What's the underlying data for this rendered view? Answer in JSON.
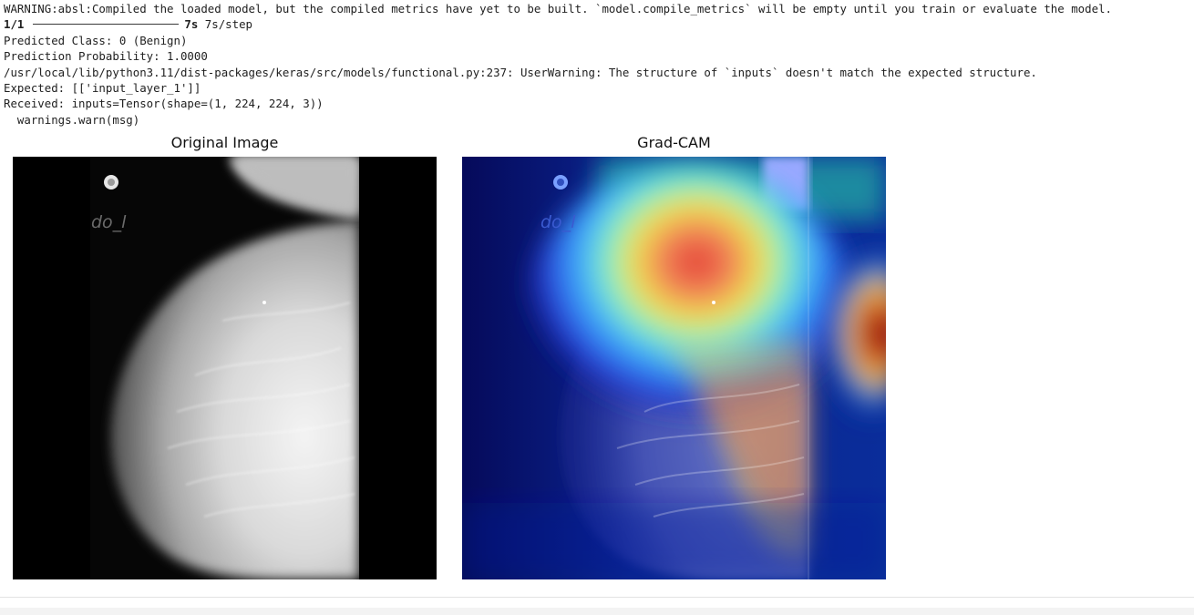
{
  "output": {
    "warning_line": "WARNING:absl:Compiled the loaded model, but the compiled metrics have yet to be built. `model.compile_metrics` will be empty until you train or evaluate the model.",
    "progress_step": "1/1",
    "progress_time": "7s",
    "progress_rate": "7s/step",
    "predicted_class": "Predicted Class: 0 (Benign)",
    "prediction_probability": "Prediction Probability: 1.0000",
    "user_warning": "/usr/local/lib/python3.11/dist-packages/keras/src/models/functional.py:237: UserWarning: The structure of `inputs` doesn't match the expected structure.",
    "expected": "Expected: [['input_layer_1']]",
    "received": "Received: inputs=Tensor(shape=(1, 224, 224, 3))",
    "warn_call": "  warnings.warn(msg)"
  },
  "figure": {
    "left_title": "Original Image",
    "right_title": "Grad-CAM",
    "image_annotation": "do_l"
  }
}
